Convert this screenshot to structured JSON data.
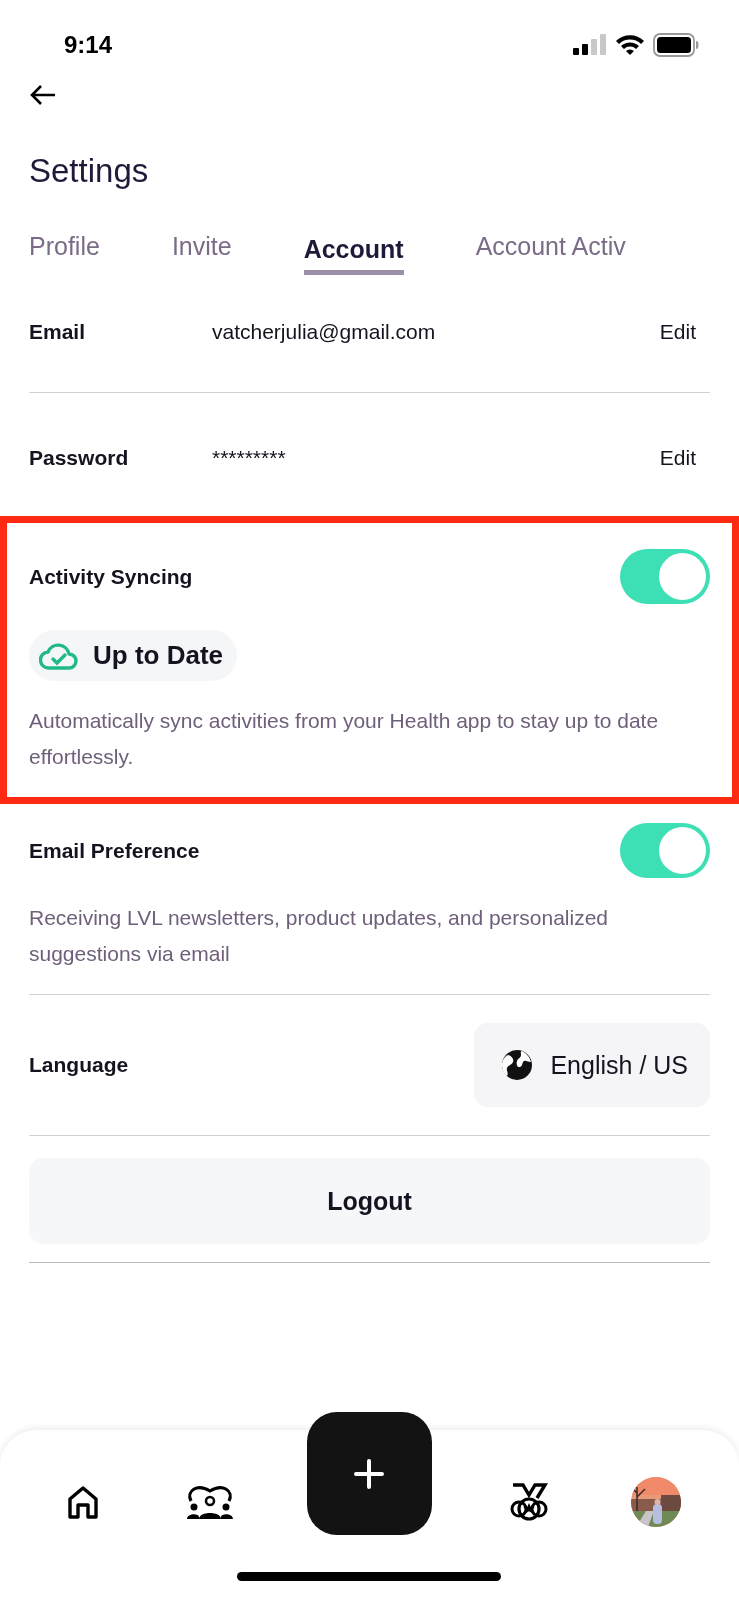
{
  "status_bar": {
    "time": "9:14"
  },
  "title": "Settings",
  "tabs": [
    {
      "label": "Profile",
      "selected": false
    },
    {
      "label": "Invite",
      "selected": false
    },
    {
      "label": "Account",
      "selected": true
    },
    {
      "label": "Account Activ",
      "selected": false
    }
  ],
  "account_rows": [
    {
      "label": "Email",
      "value": "vatcherjulia@gmail.com",
      "action": "Edit"
    },
    {
      "label": "Password",
      "value": "*********",
      "action": "Edit"
    }
  ],
  "toggle_sections": [
    {
      "label": "Activity Syncing",
      "on": true,
      "highlighted": true,
      "status": "Up to Date",
      "description": "Automatically sync activities from your Health app to stay up to date effortlessly."
    },
    {
      "label": "Email Preference",
      "on": true,
      "highlighted": false,
      "description": "Receiving LVL newsletters, product updates, and personalized suggestions via email"
    }
  ],
  "language": {
    "label": "Language",
    "value": "English / US"
  },
  "logout_button": "Logout",
  "bottom_nav": [
    {
      "kind": "home"
    },
    {
      "kind": "community"
    },
    {
      "kind": "add"
    },
    {
      "kind": "medal"
    },
    {
      "kind": "avatar"
    }
  ]
}
